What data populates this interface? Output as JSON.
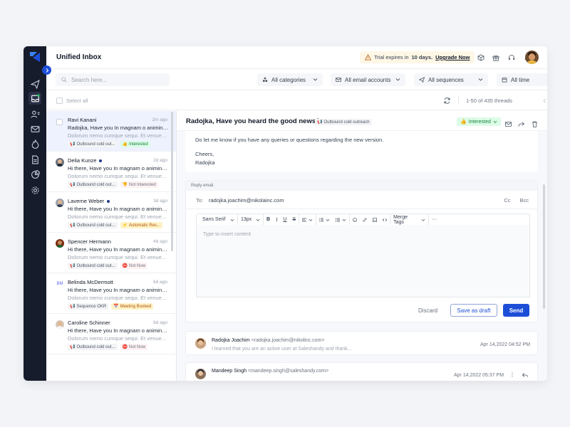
{
  "header": {
    "title": "Unified Inbox",
    "trial_prefix": "Trial expires in",
    "trial_days": "10 days.",
    "upgrade": "Upgrade Now"
  },
  "filters": {
    "search_placeholder": "Search here...",
    "categories": "All categories",
    "email_accounts": "All email accounts",
    "sequences": "All sequences",
    "time": "All time"
  },
  "listbar": {
    "select_all": "Select all",
    "count": "1-50 of 435 threads"
  },
  "threads": [
    {
      "name": "Ravi Kanani",
      "date": "2m ago",
      "subject": "Radojka, Have you In magnam o animinatio...",
      "preview": "Dolorum nemo cumque sequi. Et venuenatis...",
      "tag1": "Outbound cold out...",
      "tag2": "Interested",
      "tag2_style": "green",
      "unread": false
    },
    {
      "name": "Delia Kunze",
      "date": "2d ago",
      "subject": "Hi there, Have you In magnam o animinatio...",
      "preview": "Dolorum nemo cumque sequi. Et venuenatis...",
      "tag1": "Outbound cold out...",
      "tag2": "Not Interested",
      "tag2_style": "redish",
      "unread": true
    },
    {
      "name": "Laverne Weber",
      "date": "3d ago",
      "subject": "Hi there, Have you In magnam o animinatio...",
      "preview": "Dolorum nemo cumque sequi. Et venuenatis...",
      "tag1": "Outbound cold out...",
      "tag2": "Automatic Res...",
      "tag2_style": "orange",
      "unread": true
    },
    {
      "name": "Spencer Hermann",
      "date": "4d ago",
      "subject": "Hi there, Have you In magnam o animinatio...",
      "preview": "Dolorum nemo cumque sequi. Et venuenatis...",
      "tag1": "Outbound cold out...",
      "tag2": "Not Now",
      "tag2_style": "redish",
      "unread": false
    },
    {
      "name": "Belinda McDermott",
      "date": "6d ago",
      "subject": "Hi there, Have you In magnam o animinatio...",
      "preview": "Dolorum nemo cumque sequi. Et venuenatis...",
      "tag1": "Sequence OKR",
      "tag2": "Meeting Booked",
      "tag2_style": "orange",
      "unread": false,
      "initials": "BM"
    },
    {
      "name": "Caroline Schinner",
      "date": "6d ago",
      "subject": "Hi there, Have you In magnam o animinatio...",
      "preview": "Dolorum nemo cumque sequi. Et venuenatis...",
      "tag1": "Outbound cold out...",
      "tag2": "Not Now",
      "tag2_style": "redish",
      "unread": false
    }
  ],
  "detail": {
    "subject": "Radojka, Have you heard the good news?",
    "sequence_tag": "Outbound cold outreach",
    "status": "Interested",
    "body_line1": "Do let me know if you have any queries or questions regarding the new version.",
    "body_line2": "Cheers,",
    "body_line3": "Radojka"
  },
  "reply": {
    "label": "Reply email",
    "to_label": "To:",
    "to_value": "radojka.joachim@nikolainc.com",
    "cc": "Cc",
    "bcc": "Bcc",
    "font": "Sans Serif",
    "size": "13px",
    "merge_tags": "Merge Tags",
    "placeholder": "Type to insert content",
    "discard": "Discard",
    "save_draft": "Save as draft",
    "send": "Send"
  },
  "previous_messages": [
    {
      "name": "Radojka Joachim",
      "email": "<radojka.joachim@nikolinc.com>",
      "snippet": "I learned that you are an active user at Saleshandy and thank...",
      "date": "Apr 14,2022 04:52 PM"
    },
    {
      "name": "Mandeep Singh",
      "email": "<mandeep.singh@saleshandy.com>",
      "snippet": "",
      "date": "Apr 14,2022 05:37 PM"
    }
  ],
  "colors": {
    "accent": "#1d4ed8",
    "rail": "#171c2c",
    "interested_bg": "#dcfce7"
  }
}
